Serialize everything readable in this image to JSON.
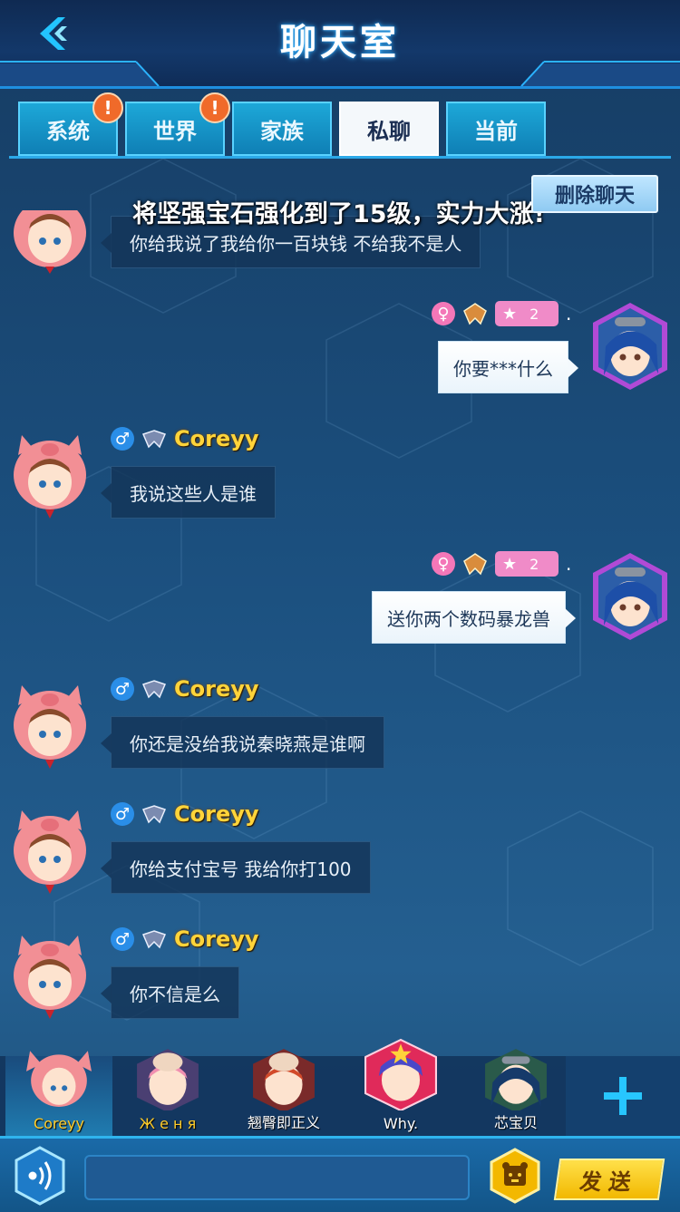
{
  "header": {
    "title": "聊天室"
  },
  "tabs": [
    {
      "label": "系统",
      "badge": "!"
    },
    {
      "label": "世界",
      "badge": "!"
    },
    {
      "label": "家族",
      "badge": ""
    },
    {
      "label": "私聊",
      "badge": ""
    },
    {
      "label": "当前",
      "badge": ""
    }
  ],
  "delete_chat_label": "删除聊天",
  "broadcast": "将坚强宝石强化到了15级，实力大涨!",
  "messages": [
    {
      "side": "left",
      "name": "",
      "gender": "♂",
      "text": "你给我说了我给你一百块钱 不给我不是人"
    },
    {
      "side": "right",
      "name": "",
      "gender": "♀",
      "vip": "2",
      "dot": ".",
      "text": "你要***什么"
    },
    {
      "side": "left",
      "name": "Coreyy",
      "gender": "♂",
      "text": "我说这些人是谁"
    },
    {
      "side": "right",
      "name": "",
      "gender": "♀",
      "vip": "2",
      "dot": ".",
      "text": "送你两个数码暴龙兽"
    },
    {
      "side": "left",
      "name": "Coreyy",
      "gender": "♂",
      "text": "你还是没给我说秦晓燕是谁啊"
    },
    {
      "side": "left",
      "name": "Coreyy",
      "gender": "♂",
      "text": "你给支付宝号  我给你打100"
    },
    {
      "side": "left",
      "name": "Coreyy",
      "gender": "♂",
      "text": "你不信是么"
    }
  ],
  "friends": [
    {
      "name": "Coreyy",
      "active": true
    },
    {
      "name": "Ж е н я",
      "active": false
    },
    {
      "name": "翘臀即正义",
      "active": false
    },
    {
      "name": "Why.",
      "active": false
    },
    {
      "name": "芯宝贝",
      "active": false
    }
  ],
  "plus_label": "+",
  "input": {
    "placeholder": "",
    "value": ""
  },
  "send_label": "发送",
  "colors": {
    "name_gold": "#ffd43a",
    "tab_active": "#f4f8fb",
    "accent": "#24c1ff"
  }
}
